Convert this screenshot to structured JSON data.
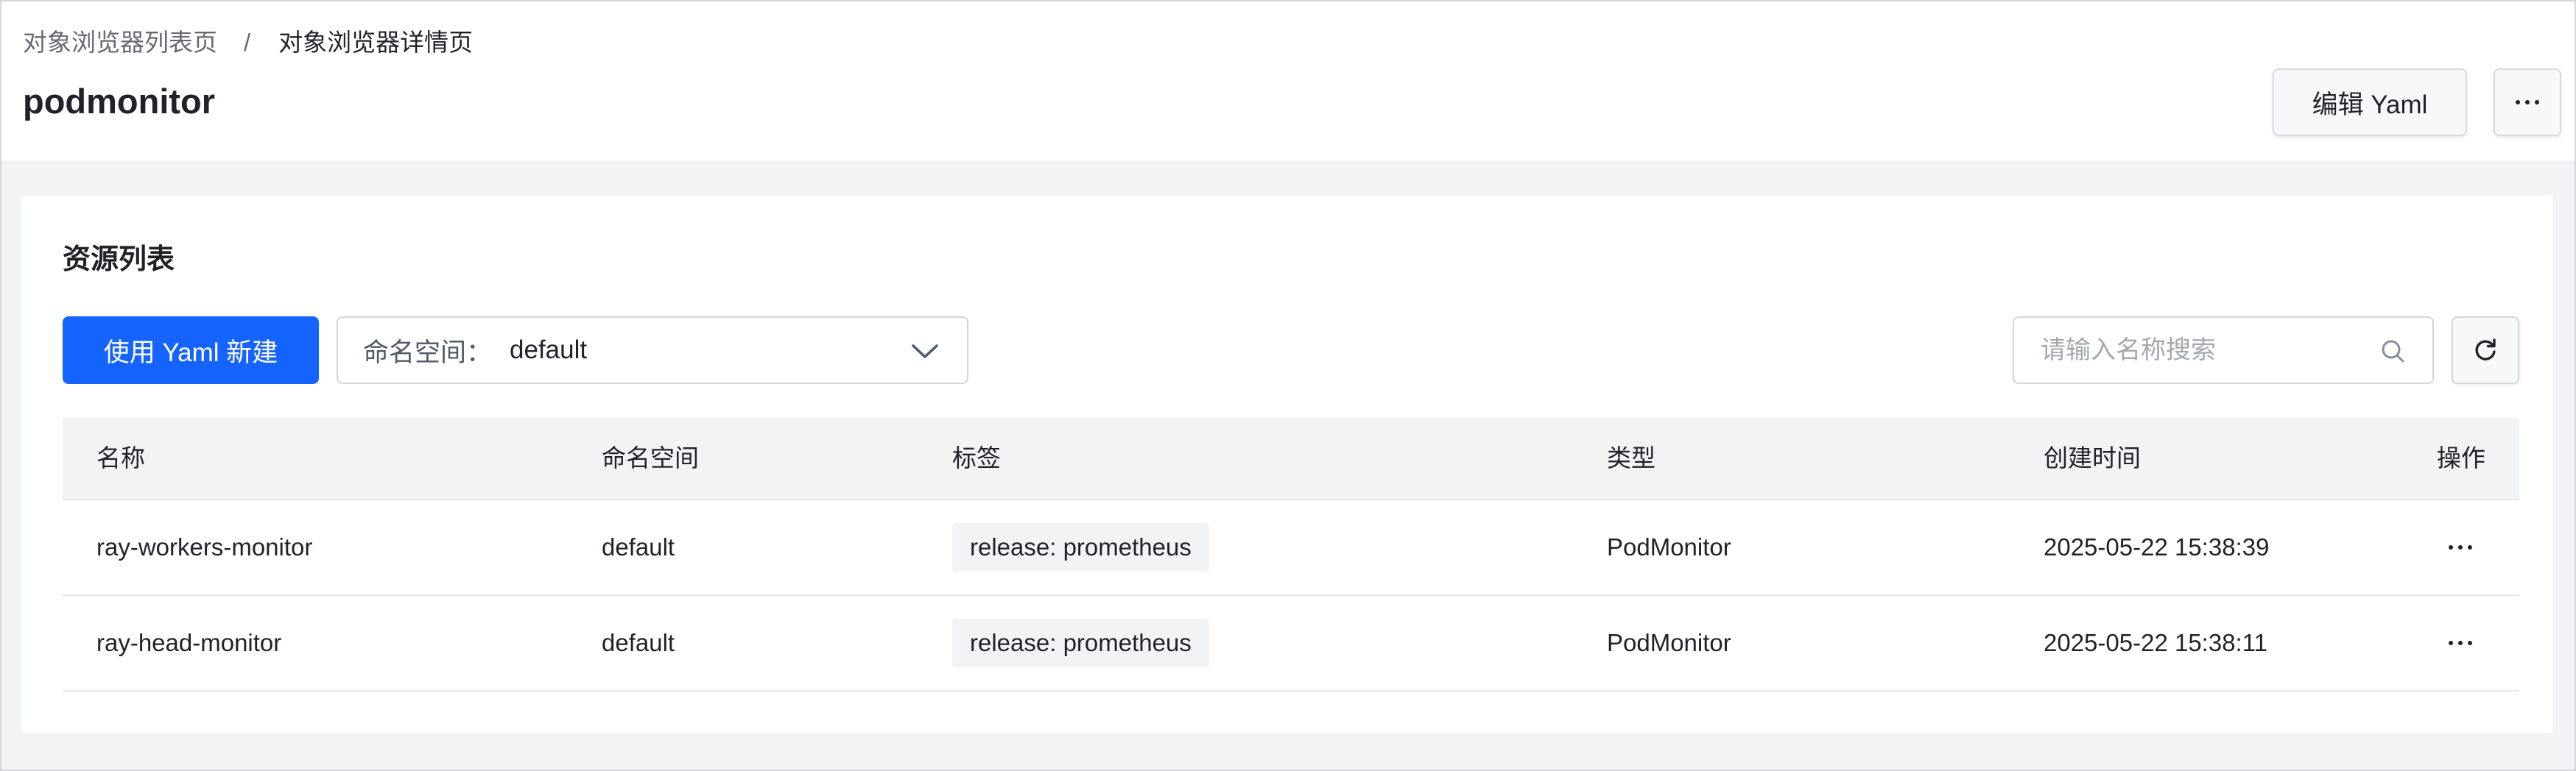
{
  "breadcrumb": {
    "parent": "对象浏览器列表页",
    "separator": "/",
    "current": "对象浏览器详情页"
  },
  "header": {
    "title": "podmonitor",
    "edit_yaml_label": "编辑 Yaml",
    "more_icon": "more-horizontal-icon"
  },
  "resource_list": {
    "title": "资源列表",
    "create_button_label": "使用 Yaml 新建",
    "namespace_select": {
      "prefix": "命名空间：",
      "value": "default",
      "icon": "chevron-down-icon"
    },
    "search": {
      "placeholder": "请输入名称搜索",
      "value": "",
      "icon": "search-icon"
    },
    "refresh_icon": "refresh-icon"
  },
  "table": {
    "columns": [
      "名称",
      "命名空间",
      "标签",
      "类型",
      "创建时间",
      "操作"
    ],
    "rows": [
      {
        "name": "ray-workers-monitor",
        "namespace": "default",
        "label": "release: prometheus",
        "type": "PodMonitor",
        "created": "2025-05-22 15:38:39"
      },
      {
        "name": "ray-head-monitor",
        "namespace": "default",
        "label": "release: prometheus",
        "type": "PodMonitor",
        "created": "2025-05-22 15:38:11"
      }
    ]
  },
  "colors": {
    "primary": "#1664ff",
    "page_background": "#f2f3f5",
    "text_primary": "#1f2329",
    "text_secondary": "#646a73"
  }
}
